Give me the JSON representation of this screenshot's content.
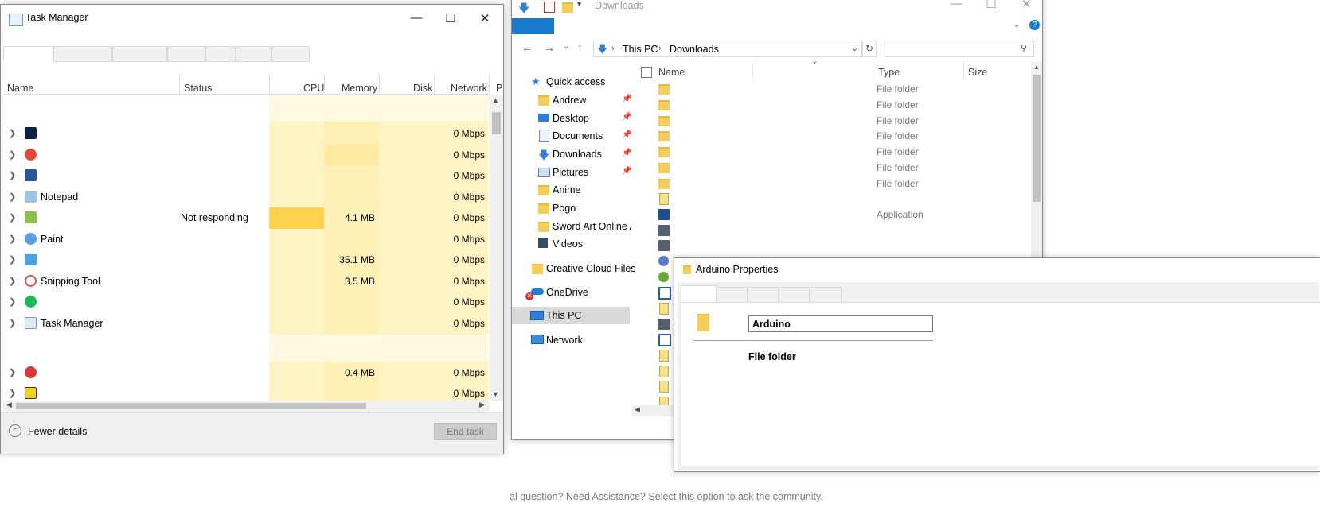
{
  "task_manager": {
    "title": "Task Manager",
    "columns": {
      "name": "Name",
      "status": "Status",
      "cpu": "CPU",
      "memory": "Memory",
      "disk": "Disk",
      "network": "Network",
      "power": "P"
    },
    "rows": [
      {
        "name": "",
        "status": "",
        "memory": "",
        "network": "0 Mbps",
        "icon": "photoshop-icon",
        "icon_color": "#0b2245"
      },
      {
        "name": "",
        "status": "",
        "memory": "",
        "network": "0 Mbps",
        "icon": "chrome-icon",
        "icon_color": "#e04a3a"
      },
      {
        "name": "",
        "status": "",
        "memory": "",
        "network": "0 Mbps",
        "icon": "word-icon",
        "icon_color": "#2b579a"
      },
      {
        "name": "Notepad",
        "status": "",
        "memory": "",
        "network": "0 Mbps",
        "icon": "notepad-icon",
        "icon_color": "#9cc6e0"
      },
      {
        "name": "",
        "status": "Not responding",
        "memory": "4.1 MB",
        "network": "0 Mbps",
        "icon": "app-icon",
        "icon_color": "#8fbf4d"
      },
      {
        "name": "Paint",
        "status": "",
        "memory": "",
        "network": "0 Mbps",
        "icon": "paint-icon",
        "icon_color": "#5aa0e0"
      },
      {
        "name": "",
        "status": "",
        "memory": "35.1 MB",
        "network": "0 Mbps",
        "icon": "explorer-icon",
        "icon_color": "#4aa3df"
      },
      {
        "name": "Snipping Tool",
        "status": "",
        "memory": "3.5 MB",
        "network": "0 Mbps",
        "icon": "scissors-icon",
        "icon_color": "#d9534f"
      },
      {
        "name": "",
        "status": "",
        "memory": "",
        "network": "0 Mbps",
        "icon": "spotify-icon",
        "icon_color": "#1db954"
      },
      {
        "name": "Task Manager",
        "status": "",
        "memory": "",
        "network": "0 Mbps",
        "icon": "taskmanager-icon",
        "icon_color": "#6c9bd0"
      },
      {
        "name": "",
        "status": "",
        "memory": "0.4 MB",
        "network": "0 Mbps",
        "icon": "red-app-icon",
        "icon_color": "#d23c3c"
      },
      {
        "name": "",
        "status": "",
        "memory": "",
        "network": "0 Mbps",
        "icon": "warning-app-icon",
        "icon_color": "#f2d21c"
      }
    ],
    "fewer_details": "Fewer details",
    "end_task": "End task"
  },
  "explorer": {
    "title": "Downloads",
    "breadcrumb": [
      "This PC",
      "Downloads"
    ],
    "search_placeholder": "",
    "nav": [
      {
        "label": "Quick access",
        "icon": "star-icon",
        "pinned": false
      },
      {
        "label": "Andrew",
        "icon": "folder-icon",
        "pinned": true
      },
      {
        "label": "Desktop",
        "icon": "desktop-icon",
        "pinned": true
      },
      {
        "label": "Documents",
        "icon": "documents-icon",
        "pinned": true
      },
      {
        "label": "Downloads",
        "icon": "download-icon",
        "pinned": true
      },
      {
        "label": "Pictures",
        "icon": "pictures-icon",
        "pinned": true
      },
      {
        "label": "Anime",
        "icon": "folder-icon",
        "pinned": false
      },
      {
        "label": "Pogo",
        "icon": "folder-icon",
        "pinned": false
      },
      {
        "label": "Sword Art Online Al",
        "icon": "folder-icon",
        "pinned": false
      },
      {
        "label": "Videos",
        "icon": "videos-icon",
        "pinned": false
      },
      {
        "label": "Creative Cloud Files",
        "icon": "creative-cloud-icon",
        "pinned": false
      },
      {
        "label": "OneDrive",
        "icon": "onedrive-icon",
        "pinned": false
      },
      {
        "label": "This PC",
        "icon": "this-pc-icon",
        "pinned": false
      },
      {
        "label": "Network",
        "icon": "network-icon",
        "pinned": false
      }
    ],
    "columns": {
      "name": "Name",
      "type": "Type",
      "size": "Size"
    },
    "files": [
      {
        "type": "File folder"
      },
      {
        "type": "File folder"
      },
      {
        "type": "File folder"
      },
      {
        "type": "File folder"
      },
      {
        "type": "File folder"
      },
      {
        "type": "File folder"
      },
      {
        "type": "File folder"
      },
      {
        "type": ""
      },
      {
        "type": "Application"
      },
      {
        "type": ""
      },
      {
        "type": ""
      },
      {
        "type": ""
      },
      {
        "type": ""
      },
      {
        "type": ""
      },
      {
        "type": ""
      },
      {
        "type": ""
      },
      {
        "type": ""
      },
      {
        "type": ""
      },
      {
        "type": ""
      },
      {
        "type": ""
      },
      {
        "type": ""
      }
    ]
  },
  "properties": {
    "title": "Arduino Properties",
    "name_value": "Arduino",
    "type_label": "File folder"
  },
  "background_text": "al question? Need Assistance? Select this option to ask the community."
}
